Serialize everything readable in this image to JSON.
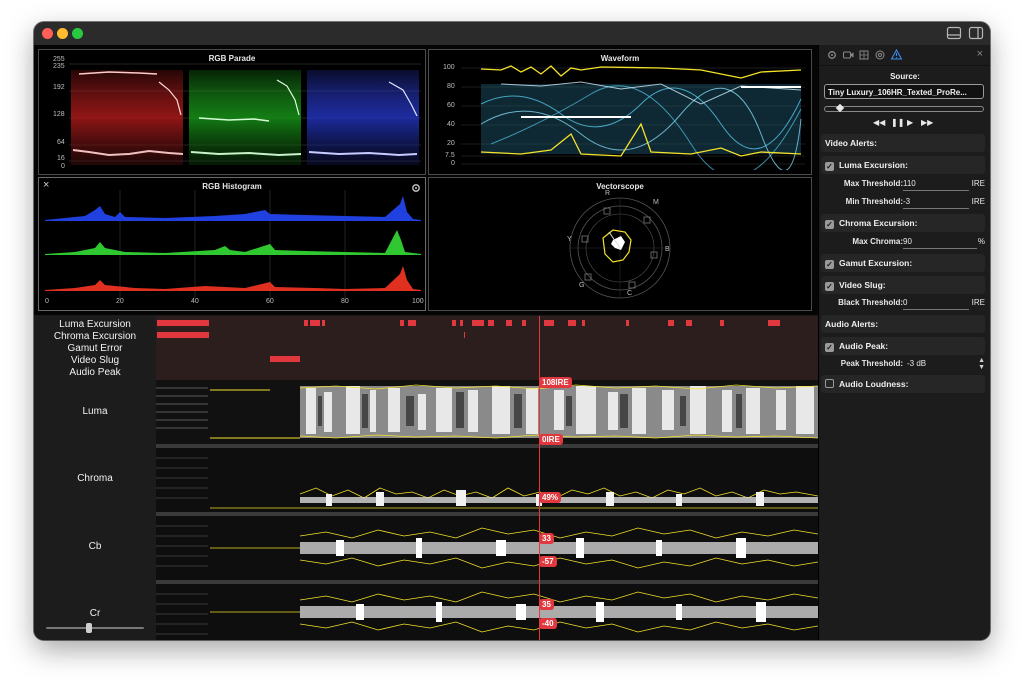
{
  "scopes": {
    "parade": {
      "title": "RGB Parade",
      "ticks": [
        "255",
        "235",
        "192",
        "128",
        "64",
        "16",
        "0"
      ]
    },
    "waveform": {
      "title": "Waveform",
      "ticks": [
        "100",
        "80",
        "60",
        "40",
        "20",
        "7.5",
        "0"
      ]
    },
    "histogram": {
      "title": "RGB Histogram",
      "ticks": [
        "0",
        "20",
        "40",
        "60",
        "80",
        "100"
      ],
      "close": "×"
    },
    "vectorscope": {
      "title": "Vectorscope",
      "targets": [
        "R",
        "M",
        "B",
        "C",
        "G",
        "Y"
      ]
    }
  },
  "timeline": {
    "alert_rows": [
      "Luma Excursion",
      "Chroma Excursion",
      "Gamut Error",
      "Video Slug",
      "Audio Peak"
    ],
    "tracks": [
      "Luma",
      "Chroma",
      "Cb",
      "Cr"
    ],
    "markers": {
      "luma_high": "108IRE",
      "luma_low": "0IRE",
      "chroma": "49%",
      "cb_high": "33",
      "cb_low": "-57",
      "cr_high": "35",
      "cr_low": "-40"
    }
  },
  "inspector": {
    "source_label": "Source:",
    "source_value": "Tiny Luxury_106HR_Texted_ProRe...",
    "transport": {
      "prev": "◀◀",
      "pause": "❚❚",
      "play": "▶",
      "next": "▶▶"
    },
    "video_alerts": "Video Alerts:",
    "luma": {
      "label": "Luma Excursion:",
      "max_label": "Max Threshold:",
      "max_value": "110",
      "min_label": "Min Threshold:",
      "min_value": "-3",
      "unit": "IRE"
    },
    "chroma": {
      "label": "Chroma Excursion:",
      "max_label": "Max Chroma:",
      "max_value": "90",
      "unit": "%"
    },
    "gamut": {
      "label": "Gamut Excursion:"
    },
    "slug": {
      "label": "Video Slug:",
      "black_label": "Black Threshold:",
      "black_value": "0",
      "unit": "IRE"
    },
    "audio_alerts": "Audio Alerts:",
    "peak": {
      "label": "Audio Peak:",
      "threshold_label": "Peak Threshold:",
      "threshold_value": "-3 dB"
    },
    "loudness": {
      "label": "Audio Loudness:"
    },
    "tab_icons": [
      "gear-icon",
      "camera-icon",
      "cube-icon",
      "target-icon",
      "warning-icon"
    ]
  },
  "colors": {
    "alert_red": "#e0383e",
    "waveform_cyan": "#53c4e6",
    "waveform_yellow": "#f5e22a",
    "playhead": "#e0383e"
  }
}
